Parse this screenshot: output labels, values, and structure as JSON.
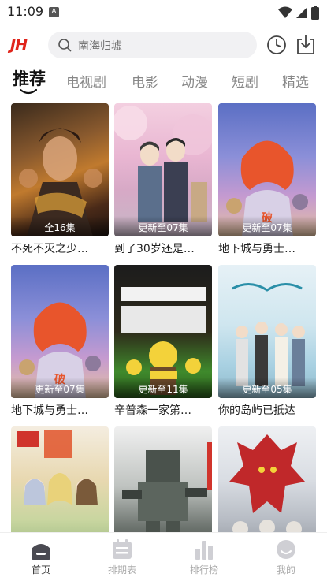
{
  "status_bar": {
    "time": "11:09",
    "notification_letter": "A"
  },
  "header": {
    "logo_text": "JH",
    "search_placeholder": "南海归墟",
    "brand_color": "#e0241b"
  },
  "tabs": [
    {
      "label": "推荐",
      "active": true
    },
    {
      "label": "电视剧",
      "active": false
    },
    {
      "label": "电影",
      "active": false
    },
    {
      "label": "动漫",
      "active": false
    },
    {
      "label": "短剧",
      "active": false
    },
    {
      "label": "精选",
      "active": false
    }
  ],
  "cards": [
    {
      "title": "不死不灭之少…",
      "episodes": "全16集"
    },
    {
      "title": "到了30岁还是…",
      "episodes": "更新至07集"
    },
    {
      "title": "地下城与勇士…",
      "episodes": "更新至07集"
    },
    {
      "title": "地下城与勇士…",
      "episodes": "更新至07集"
    },
    {
      "title": "辛普森一家第…",
      "episodes": "更新至11集"
    },
    {
      "title": "你的岛屿已抵达",
      "episodes": "更新至05集"
    },
    {
      "title": "",
      "episodes": ""
    },
    {
      "title": "",
      "episodes": ""
    },
    {
      "title": "",
      "episodes": ""
    }
  ],
  "bottom_nav": [
    {
      "label": "首页",
      "icon": "home-icon",
      "active": true
    },
    {
      "label": "排期表",
      "icon": "schedule-icon",
      "active": false
    },
    {
      "label": "排行榜",
      "icon": "ranking-icon",
      "active": false
    },
    {
      "label": "我的",
      "icon": "profile-icon",
      "active": false
    }
  ]
}
